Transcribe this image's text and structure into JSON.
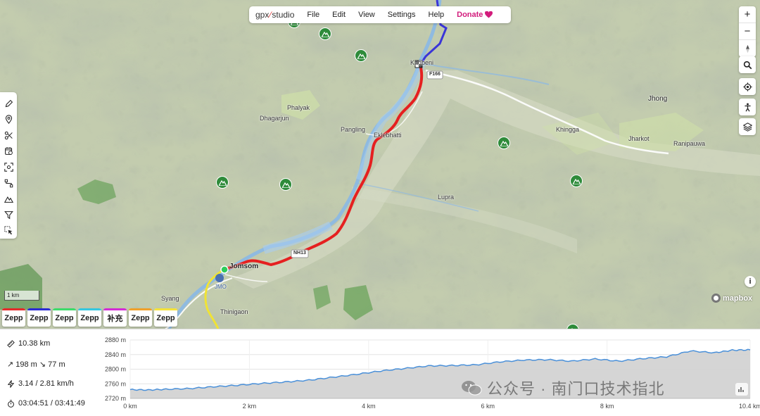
{
  "app": {
    "logo_gpx": "gpx",
    "logo_studio": "studio",
    "menu": [
      "File",
      "Edit",
      "View",
      "Settings",
      "Help"
    ],
    "donate": "Donate"
  },
  "toolbar": {
    "tools": [
      "pencil-icon",
      "map-pin-icon",
      "scissors-icon",
      "calendar-clock-icon",
      "scan-icon",
      "waypoints-icon",
      "mountain-icon",
      "filter-icon",
      "select-icon"
    ]
  },
  "map_controls": {
    "zoom_in": "+",
    "zoom_out": "−",
    "compass": "▲",
    "info": "i"
  },
  "map": {
    "labels": {
      "kagbeni": "Kagbeni",
      "phalyak": "Phalyak",
      "dhagarjun": "Dhagarjun",
      "pangling": "Pangling",
      "eklebhatti": "Eklebhatti",
      "lupra": "Lupra",
      "jhong": "Jhong",
      "khingga": "Khingga",
      "jharkot": "Jharkot",
      "ranipauwa": "Ranipauwa",
      "jomsom": "Jomsom",
      "jmo": "JMO",
      "syang": "Syang",
      "thinigaon": "Thinigaon",
      "f166": "F166",
      "road_sign": "NH13"
    },
    "scale": "1 km",
    "attribution": "mapbox"
  },
  "tabs": [
    {
      "label": "Zepp",
      "color": "#e52b2b"
    },
    {
      "label": "Zepp",
      "color": "#2b2bd6"
    },
    {
      "label": "Zepp",
      "color": "#3ddc6a"
    },
    {
      "label": "Zepp",
      "color": "#35c8e0"
    },
    {
      "label": "补充",
      "color": "#d42bd6"
    },
    {
      "label": "Zepp",
      "color": "#f0a12b"
    },
    {
      "label": "Zepp",
      "color": "#f5e33a"
    }
  ],
  "stats": {
    "distance": "10.38 km",
    "elevation": "↗ 198 m ↘ 77 m",
    "speed": "3.14 / 2.81 km/h",
    "time": "03:04:51 / 03:41:49"
  },
  "chart_data": {
    "type": "area",
    "title": "",
    "xlabel": "",
    "ylabel": "",
    "x_tick_labels": [
      "0 km",
      "2 km",
      "4 km",
      "6 km",
      "8 km",
      "10.4 km"
    ],
    "y_tick_labels": [
      "2720 m",
      "2760 m",
      "2800 m",
      "2840 m",
      "2880 m"
    ],
    "xlim": [
      0,
      10.4
    ],
    "ylim": [
      2720,
      2880
    ],
    "grid": true,
    "series": [
      {
        "color": "#4a90d9",
        "x": [
          0,
          0.3,
          0.6,
          1.0,
          1.4,
          1.8,
          2.2,
          2.6,
          3.0,
          3.4,
          3.8,
          4.2,
          4.6,
          5.0,
          5.4,
          5.8,
          6.2,
          6.6,
          7.0,
          7.4,
          7.8,
          8.2,
          8.6,
          9.0,
          9.4,
          9.8,
          10.1,
          10.4
        ],
        "y": [
          2744,
          2743,
          2745,
          2747,
          2752,
          2756,
          2761,
          2765,
          2770,
          2778,
          2786,
          2795,
          2802,
          2809,
          2810,
          2812,
          2820,
          2825,
          2826,
          2822,
          2828,
          2822,
          2829,
          2834,
          2850,
          2845,
          2852,
          2853
        ]
      }
    ]
  },
  "watermark": "公众号 · 南门口技术指北"
}
